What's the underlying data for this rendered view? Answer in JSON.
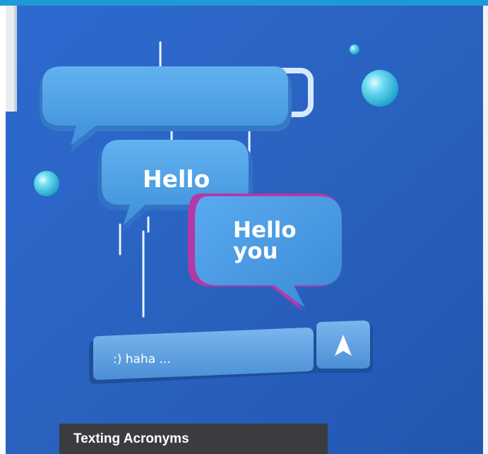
{
  "caption": {
    "title": "Texting Acronyms"
  },
  "bubbles": {
    "hello": "Hello",
    "hello_you_line1": "Hello",
    "hello_you_line2": "you"
  },
  "message_bar": {
    "value": ":) haha ...",
    "send_icon": "send-arrow-icon"
  },
  "colors": {
    "top_accent": "#1e9ad6",
    "background": "#2c63c2",
    "bubble": "#4da0e6",
    "caption_bg": "#3a3c40"
  }
}
